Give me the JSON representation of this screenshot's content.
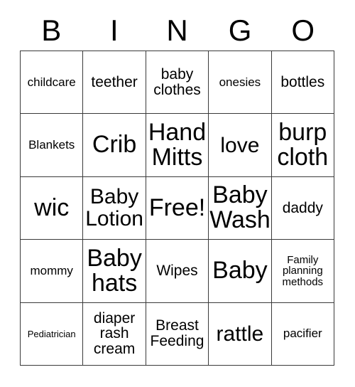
{
  "card": {
    "title": "BINGO",
    "header_letters": [
      "B",
      "I",
      "N",
      "G",
      "O"
    ],
    "free_space_label": "Free!",
    "colors": {
      "background": "#ffffff",
      "text": "#000000",
      "grid_line": "#3a3a3a"
    },
    "rows": [
      [
        {
          "label": "childcare",
          "size": "sm"
        },
        {
          "label": "teether",
          "size": "md"
        },
        {
          "label": "baby\nclothes",
          "size": "md"
        },
        {
          "label": "onesies",
          "size": "sm"
        },
        {
          "label": "bottles",
          "size": "md"
        }
      ],
      [
        {
          "label": "Blankets",
          "size": "sm"
        },
        {
          "label": "Crib",
          "size": "xxl"
        },
        {
          "label": "Hand\nMitts",
          "size": "xxl"
        },
        {
          "label": "love",
          "size": "xl"
        },
        {
          "label": "burp\ncloth",
          "size": "xxl"
        }
      ],
      [
        {
          "label": "wic",
          "size": "xxl"
        },
        {
          "label": "Baby\nLotion",
          "size": "xl"
        },
        {
          "label": "Free!",
          "size": "xxl"
        },
        {
          "label": "Baby\nWash",
          "size": "xxl"
        },
        {
          "label": "daddy",
          "size": "md"
        }
      ],
      [
        {
          "label": "mommy",
          "size": "sm"
        },
        {
          "label": "Baby\nhats",
          "size": "xxl"
        },
        {
          "label": "Wipes",
          "size": "md"
        },
        {
          "label": "Baby",
          "size": "xxl"
        },
        {
          "label": "Family\nplanning\nmethods",
          "size": "xs"
        }
      ],
      [
        {
          "label": "Pediatrician",
          "size": "xxs"
        },
        {
          "label": "diaper\nrash\ncream",
          "size": "md"
        },
        {
          "label": "Breast\nFeeding",
          "size": "md"
        },
        {
          "label": "rattle",
          "size": "xl"
        },
        {
          "label": "pacifier",
          "size": "sm"
        }
      ]
    ]
  }
}
